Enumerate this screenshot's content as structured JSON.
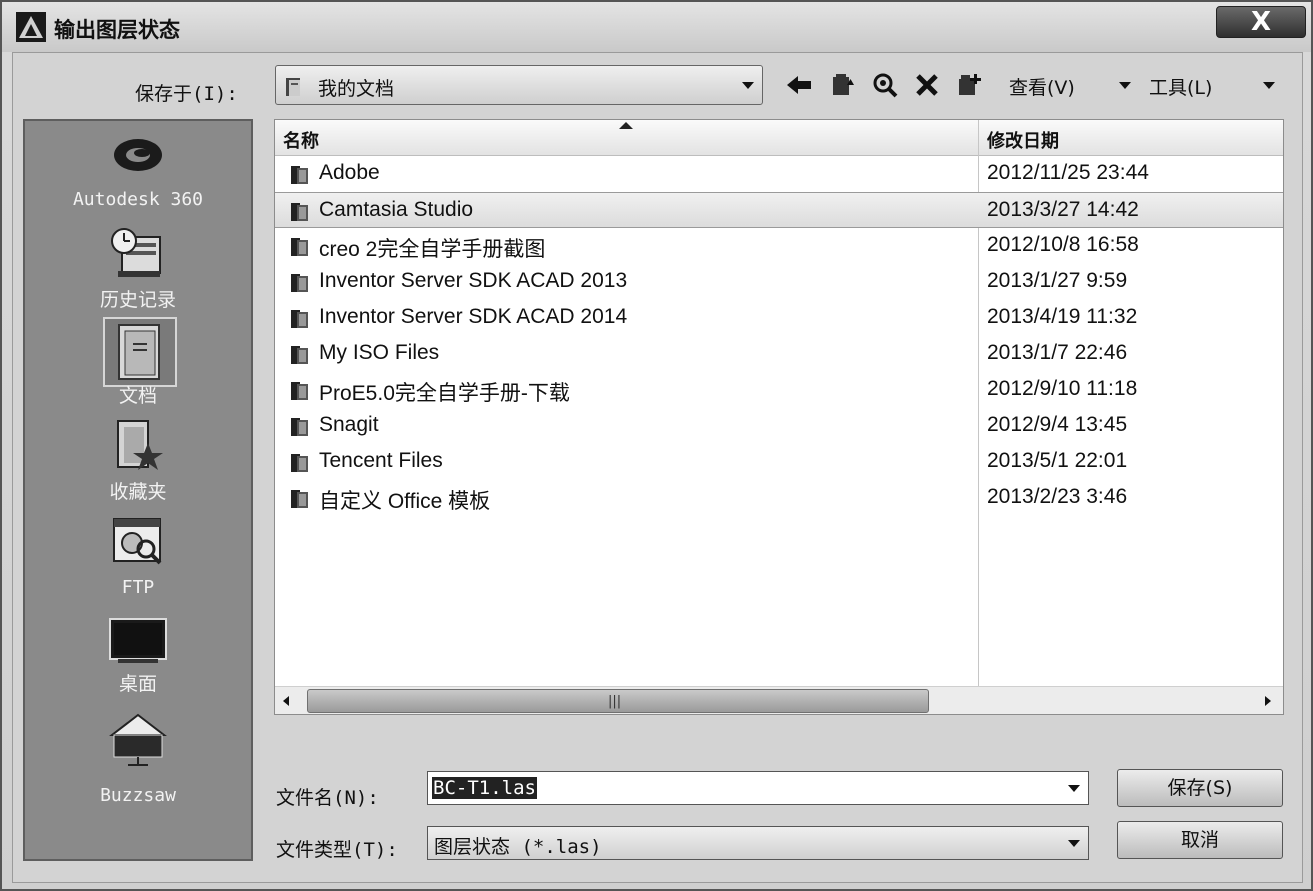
{
  "window": {
    "title": "输出图层状态",
    "close_label": "X"
  },
  "toolbar": {
    "save_in_label": "保存于(I):",
    "location": "我的文档",
    "view_label": "查看(V)",
    "tools_label": "工具(L)"
  },
  "places": [
    {
      "label": "Autodesk 360",
      "icon": "autodesk-360-icon"
    },
    {
      "label": "历史记录",
      "icon": "history-icon"
    },
    {
      "label": "文档",
      "icon": "documents-folder-icon"
    },
    {
      "label": "收藏夹",
      "icon": "favorites-icon"
    },
    {
      "label": "FTP",
      "icon": "ftp-icon"
    },
    {
      "label": "桌面",
      "icon": "desktop-icon"
    },
    {
      "label": "Buzzsaw",
      "icon": "buzzsaw-icon"
    }
  ],
  "filelist": {
    "columns": {
      "name": "名称",
      "modified": "修改日期"
    },
    "rows": [
      {
        "name": "Adobe",
        "modified": "2012/11/25 23:44"
      },
      {
        "name": "Camtasia Studio",
        "modified": "2013/3/27 14:42",
        "selected": true
      },
      {
        "name": "creo 2完全自学手册截图",
        "modified": "2012/10/8 16:58"
      },
      {
        "name": "Inventor Server SDK ACAD 2013",
        "modified": "2013/1/27 9:59"
      },
      {
        "name": "Inventor Server SDK ACAD 2014",
        "modified": "2013/4/19 11:32"
      },
      {
        "name": "My ISO Files",
        "modified": "2013/1/7 22:46"
      },
      {
        "name": "ProE5.0完全自学手册-下载",
        "modified": "2012/9/10 11:18"
      },
      {
        "name": "Snagit",
        "modified": "2012/9/4 13:45"
      },
      {
        "name": "Tencent Files",
        "modified": "2013/5/1 22:01"
      },
      {
        "name": "自定义 Office 模板",
        "modified": "2013/2/23 3:46"
      }
    ]
  },
  "bottom": {
    "filename_label": "文件名(N):",
    "filename_value": "BC-T1.las",
    "filetype_label": "文件类型(T):",
    "filetype_value": "图层状态 (*.las)",
    "save_button": "保存(S)",
    "cancel_button": "取消"
  }
}
